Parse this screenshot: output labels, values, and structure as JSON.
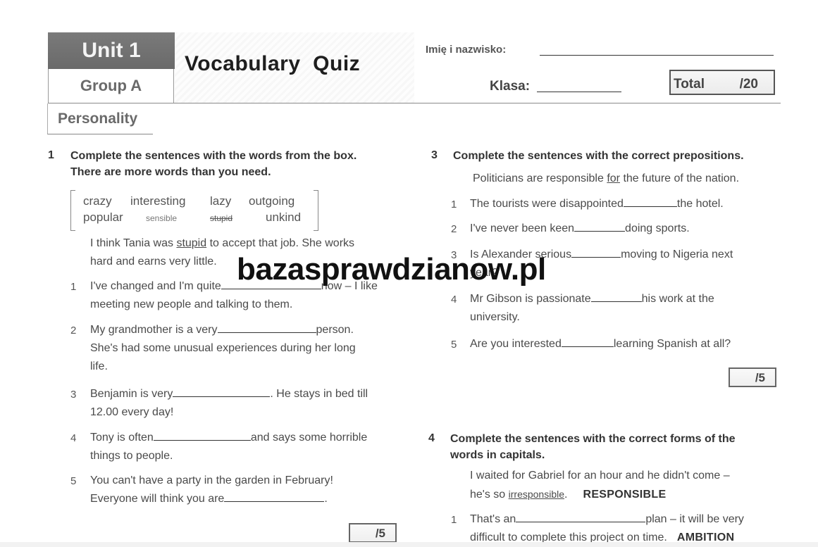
{
  "header": {
    "unit": "Unit 1",
    "group": "Group A",
    "title": "Vocabulary  Quiz",
    "topic": "Personality",
    "name_label": "Imię i nazwisko:",
    "class_label": "Klasa:",
    "total_label": "Total",
    "total_value": "/20"
  },
  "exercise1": {
    "number": "1",
    "instruction_line1": "Complete the sentences with the words from the box.",
    "instruction_line2": "There are more words than you need.",
    "words": [
      "crazy",
      "interesting",
      "lazy",
      "outgoing",
      "popular",
      "sensible",
      "stupid",
      "unkind"
    ],
    "example": {
      "before": "I think Tania was ",
      "answer": "stupid",
      "after": " to accept that job. She works",
      "line2": "hard and earns very little."
    },
    "items": [
      {
        "num": "1",
        "before": "I've changed and I'm quite",
        "after": "now – I like",
        "line2": "meeting new people and talking to them."
      },
      {
        "num": "2",
        "before": "My grandmother is a very",
        "after": "person.",
        "line2": "She's had some unusual experiences during her long",
        "line3": "life."
      },
      {
        "num": "3",
        "before": "Benjamin is very",
        "after": ". He stays in bed till",
        "line2": "12.00 every day!"
      },
      {
        "num": "4",
        "before": "Tony is often",
        "after": "and says some horrible",
        "line2": "things to people."
      },
      {
        "num": "5",
        "before": "You can't have a party in the garden in February!",
        "line2_before": "Everyone will think you are",
        "line2_after": "."
      }
    ],
    "score": "/5"
  },
  "exercise3": {
    "number": "3",
    "instruction": "Complete the sentences with the correct prepositions.",
    "example": {
      "before": "Politicians are responsible ",
      "answer": "for",
      "after": " the future of the nation."
    },
    "items": [
      {
        "num": "1",
        "before": "The tourists were disappointed",
        "after": "the hotel."
      },
      {
        "num": "2",
        "before": "I've never been keen",
        "after": "doing sports."
      },
      {
        "num": "3",
        "before": "Is Alexander serious",
        "after": "moving to Nigeria next",
        "line2": "year?"
      },
      {
        "num": "4",
        "before": "Mr Gibson is passionate",
        "after": "his work at the",
        "line2": "university."
      },
      {
        "num": "5",
        "before": "Are you interested",
        "after": "learning Spanish at all?"
      }
    ],
    "score": "/5"
  },
  "exercise4": {
    "number": "4",
    "instruction_line1": "Complete the sentences with the correct forms of the",
    "instruction_line2": "words in capitals.",
    "example": {
      "line1": "I waited for Gabriel for an hour and he didn't come –",
      "before": "he's so ",
      "answer": "irresponsible",
      "after": ".",
      "keyword": "RESPONSIBLE"
    },
    "items": [
      {
        "num": "1",
        "before": "That's an",
        "after": "plan – it will be very",
        "line2": "difficult to complete this project on time.",
        "keyword": "AMBITION"
      }
    ]
  },
  "watermark": "bazasprawdzianow.pl"
}
